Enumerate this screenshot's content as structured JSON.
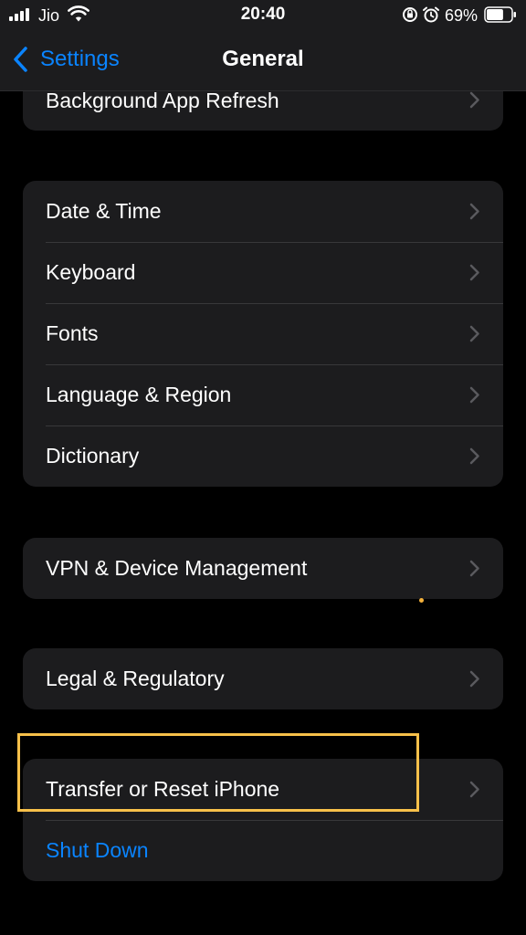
{
  "status_bar": {
    "carrier": "Jio",
    "time": "20:40",
    "battery_percent": "69%",
    "signal_bars": 4,
    "battery_level": 0.69,
    "icons": [
      "signal-icon",
      "wifi-icon",
      "orientation-lock-icon",
      "alarm-icon",
      "battery-icon"
    ]
  },
  "nav": {
    "back_label": "Settings",
    "title": "General"
  },
  "groups": [
    {
      "rows": [
        {
          "label": "Background App Refresh"
        }
      ]
    },
    {
      "rows": [
        {
          "label": "Date & Time"
        },
        {
          "label": "Keyboard"
        },
        {
          "label": "Fonts"
        },
        {
          "label": "Language & Region"
        },
        {
          "label": "Dictionary"
        }
      ]
    },
    {
      "rows": [
        {
          "label": "VPN & Device Management"
        }
      ]
    },
    {
      "rows": [
        {
          "label": "Legal & Regulatory"
        }
      ]
    },
    {
      "rows": [
        {
          "label": "Transfer or Reset iPhone"
        },
        {
          "label": "Shut Down"
        }
      ]
    }
  ],
  "colors": {
    "background": "#000000",
    "cell": "#1c1c1e",
    "accent": "#0a84ff",
    "highlight": "#f7c04a"
  }
}
